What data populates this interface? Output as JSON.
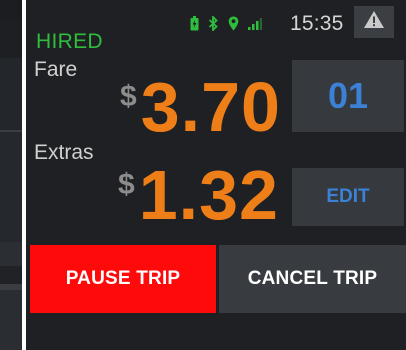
{
  "status_bar": {
    "time": "15:35",
    "icons": [
      "battery-icon",
      "bluetooth-icon",
      "location-icon",
      "signal-icon",
      "warning-icon"
    ],
    "icon_color": "#2fbd3d"
  },
  "trip": {
    "status": "HIRED",
    "fare": {
      "label": "Fare",
      "currency": "$",
      "amount": "3.70"
    },
    "extras": {
      "label": "Extras",
      "currency": "$",
      "amount": "1.32"
    },
    "passenger_count": "01",
    "edit_label": "EDIT"
  },
  "actions": {
    "pause_label": "PAUSE TRIP",
    "cancel_label": "CANCEL TRIP"
  },
  "colors": {
    "amount": "#ee7e17",
    "status": "#2fbd3d",
    "accent_blue": "#3b82d6",
    "pause": "#ff0a0a",
    "panel": "#1f2023"
  }
}
